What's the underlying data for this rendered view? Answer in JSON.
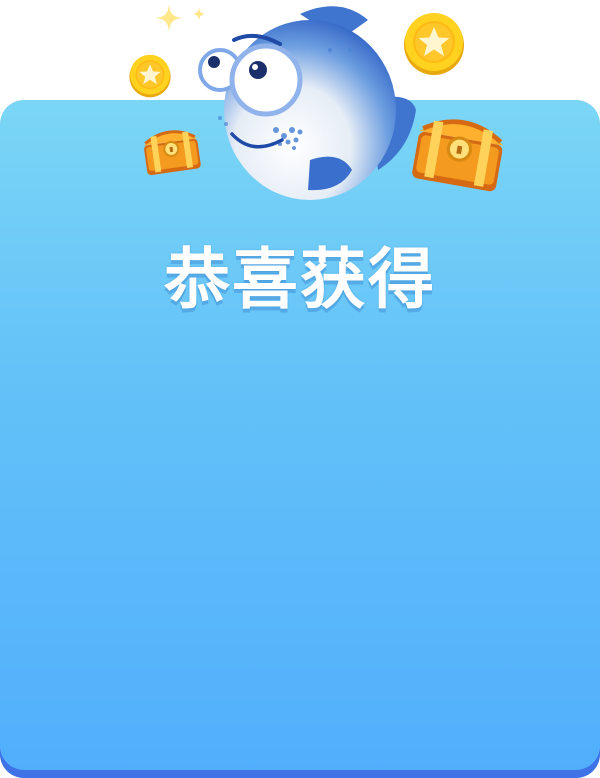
{
  "reward": {
    "title": "恭喜获得"
  },
  "colors": {
    "panel_top": "#7bd6f6",
    "panel_bottom": "#51aefc",
    "panel_edge": "#3f72e6",
    "coin": "#ffd21f",
    "chest": "#f39a1f",
    "fish_body": "#4f87d9"
  },
  "icons": [
    "fish-mascot-icon",
    "coin-icon",
    "treasure-chest-icon",
    "sparkle-icon"
  ]
}
